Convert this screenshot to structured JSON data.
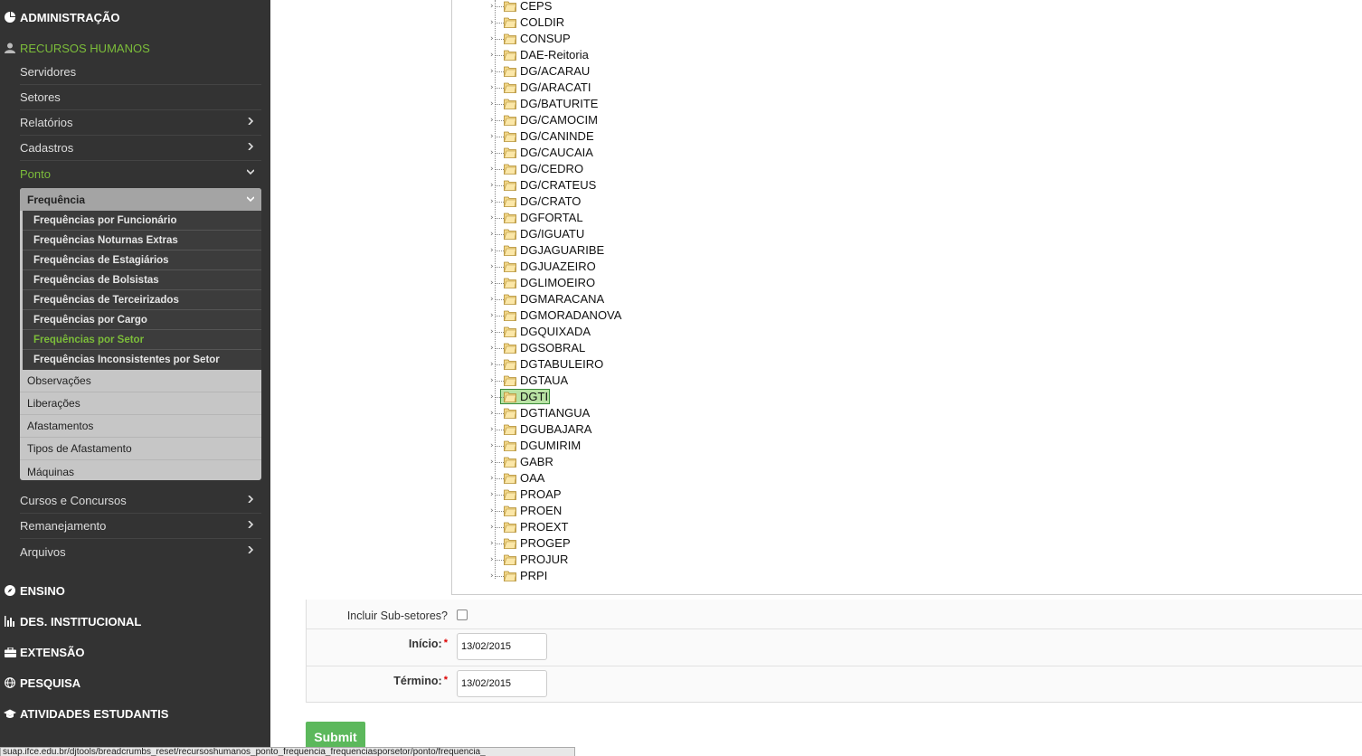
{
  "sidebar": {
    "top_items": [
      {
        "label": "ADMINISTRAÇÃO",
        "icon": "pie-chart-icon"
      },
      {
        "label": "RECURSOS HUMANOS",
        "icon": "user-icon"
      },
      {
        "label": "ENSINO",
        "icon": "compass-icon"
      },
      {
        "label": "DES. INSTITUCIONAL",
        "icon": "bar-chart-icon"
      },
      {
        "label": "EXTENSÃO",
        "icon": "briefcase-icon"
      },
      {
        "label": "PESQUISA",
        "icon": "globe-icon"
      },
      {
        "label": "ATIVIDADES ESTUDANTIS",
        "icon": "graduation-cap-icon"
      }
    ],
    "rh_items": [
      {
        "label": "Servidores"
      },
      {
        "label": "Setores"
      },
      {
        "label": "Relatórios"
      },
      {
        "label": "Cadastros"
      },
      {
        "label": "Ponto"
      }
    ],
    "ponto": {
      "header": "Frequência",
      "freq_items": [
        "Frequências por Funcionário",
        "Frequências Noturnas Extras",
        "Frequências de Estagiários",
        "Frequências de Bolsistas",
        "Frequências de Terceirizados",
        "Frequências por Cargo",
        "Frequências por Setor",
        "Frequências Inconsistentes por Setor"
      ],
      "other_items": [
        "Observações",
        "Liberações",
        "Afastamentos",
        "Tipos de Afastamento",
        "Máquinas"
      ]
    },
    "rh_items_after": [
      {
        "label": "Cursos e Concursos"
      },
      {
        "label": "Remanejamento"
      },
      {
        "label": "Arquivos"
      }
    ]
  },
  "tree": {
    "nodes": [
      "CEPS",
      "COLDIR",
      "CONSUP",
      "DAE-Reitoria",
      "DG/ACARAU",
      "DG/ARACATI",
      "DG/BATURITE",
      "DG/CAMOCIM",
      "DG/CANINDE",
      "DG/CAUCAIA",
      "DG/CEDRO",
      "DG/CRATEUS",
      "DG/CRATO",
      "DGFORTAL",
      "DG/IGUATU",
      "DGJAGUARIBE",
      "DGJUAZEIRO",
      "DGLIMOEIRO",
      "DGMARACANA",
      "DGMORADANOVA",
      "DGQUIXADA",
      "DGSOBRAL",
      "DGTABULEIRO",
      "DGTAUA",
      "DGTI",
      "DGTIANGUA",
      "DGUBAJARA",
      "DGUMIRIM",
      "GABR",
      "OAA",
      "PROAP",
      "PROEN",
      "PROEXT",
      "PROGEP",
      "PROJUR",
      "PRPI"
    ],
    "selected": "DGTI"
  },
  "form": {
    "subsetores_label": "Incluir Sub-setores?",
    "inicio_label": "Início:",
    "inicio_value": "13/02/2015",
    "termino_label": "Término:",
    "termino_value": "13/02/2015",
    "required_mark": "*"
  },
  "submit_label": "Submit",
  "status_url": "suap.ifce.edu.br/djtools/breadcrumbs_reset/recursoshumanos_ponto_frequencia_frequenciasporsetor/ponto/frequencia_"
}
